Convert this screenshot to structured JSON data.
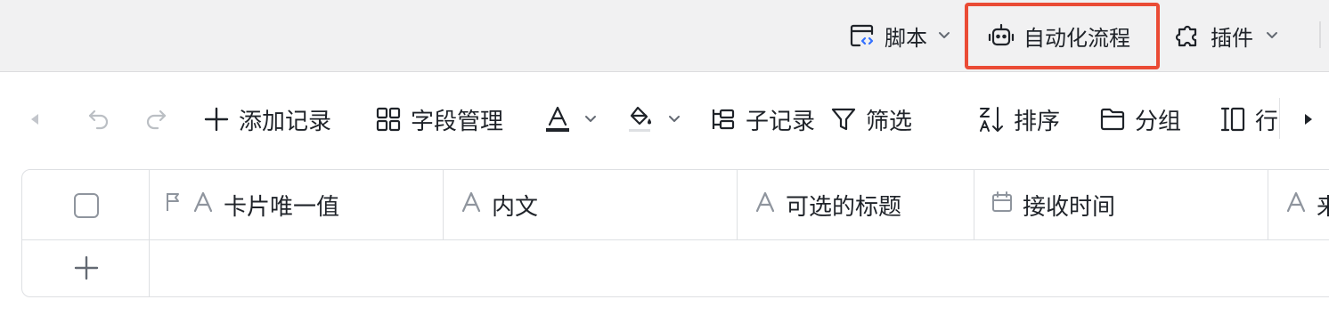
{
  "topbar": {
    "script_label": "脚本",
    "automation_label": "自动化流程",
    "plugin_label": "插件"
  },
  "toolbar": {
    "add_record_label": "添加记录",
    "field_manage_label": "字段管理",
    "sub_record_label": "子记录",
    "filter_label": "筛选",
    "sort_label": "排序",
    "group_label": "分组",
    "row_label": "行"
  },
  "grid": {
    "columns": [
      {
        "label": "卡片唯一值",
        "type_icon": "text-icon"
      },
      {
        "label": "内文",
        "type_icon": "text-icon"
      },
      {
        "label": "可选的标题",
        "type_icon": "text-icon"
      },
      {
        "label": "接收时间",
        "type_icon": "calendar-icon"
      },
      {
        "label": "来",
        "type_icon": "text-icon"
      }
    ]
  },
  "colors": {
    "highlight": "#ea4b35",
    "text": "#1f2329",
    "muted": "#8f959e",
    "border": "#dee0e3",
    "topbar_bg": "#f1f1f2",
    "accent_blue": "#3370ff"
  }
}
